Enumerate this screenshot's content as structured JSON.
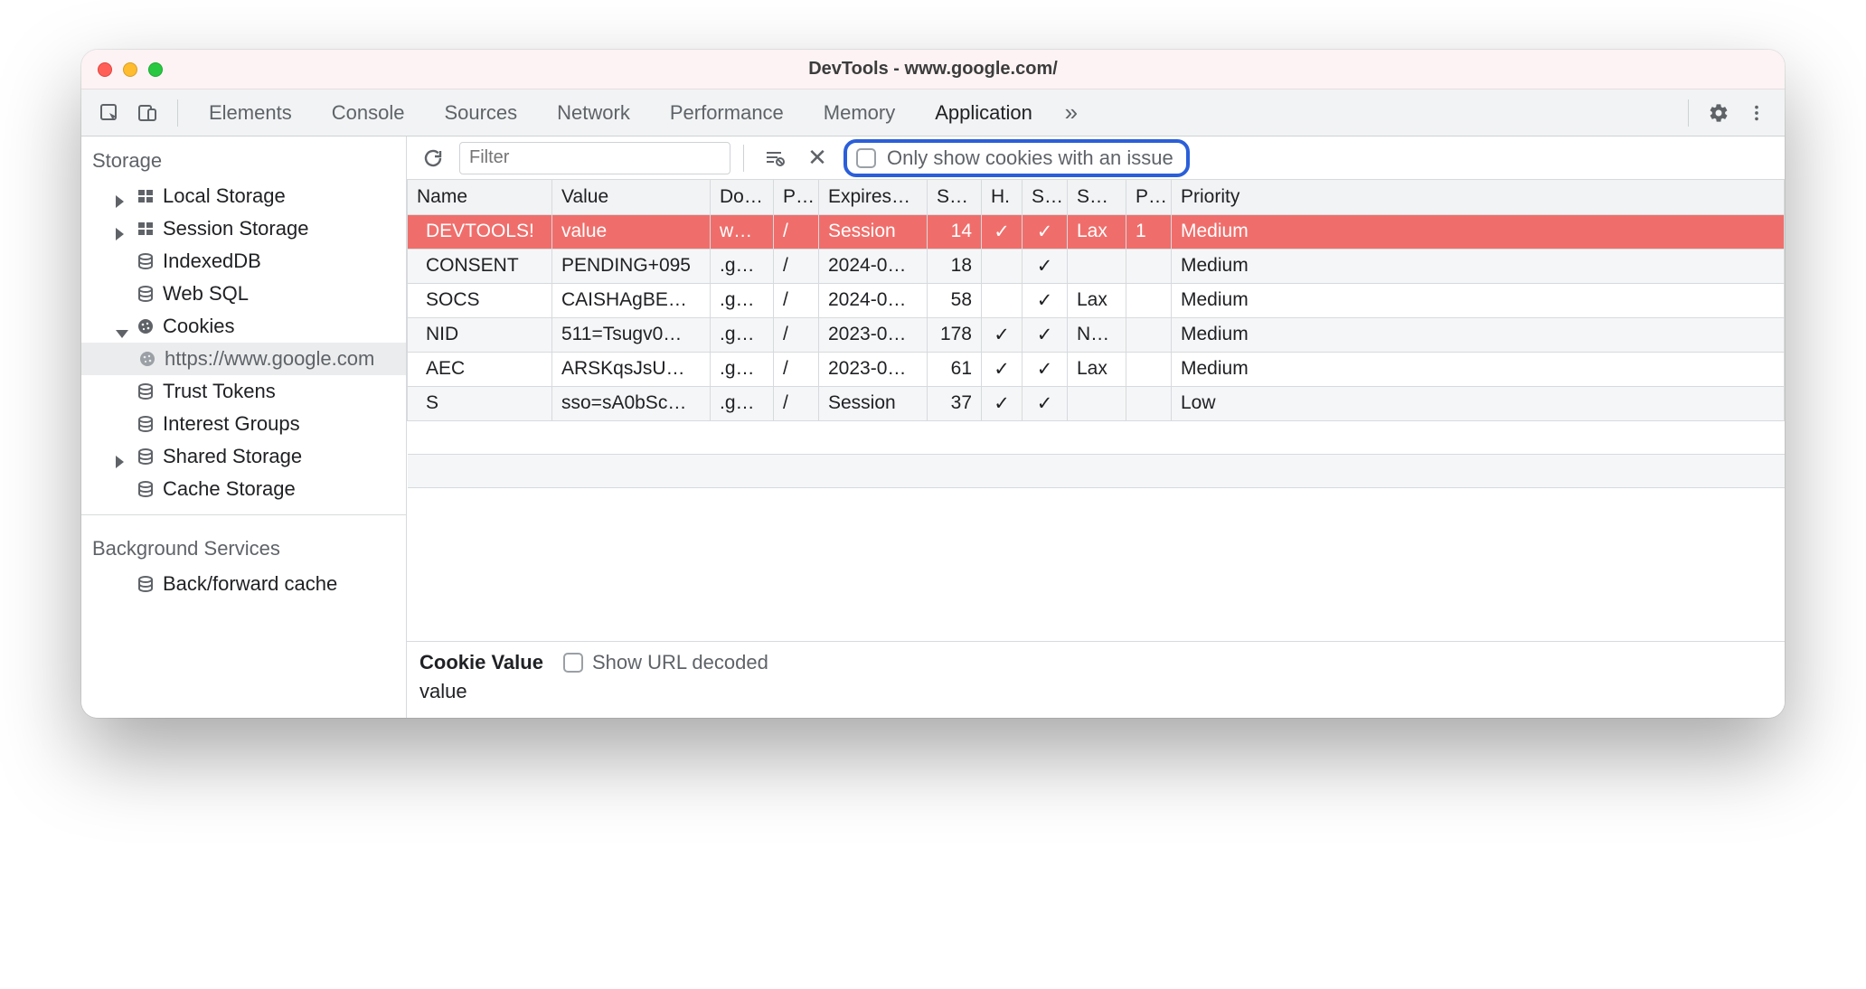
{
  "window_title": "DevTools - www.google.com/",
  "tabs": {
    "elements": "Elements",
    "console": "Console",
    "sources": "Sources",
    "network": "Network",
    "performance": "Performance",
    "memory": "Memory",
    "application": "Application"
  },
  "sidebar": {
    "group_storage": "Storage",
    "items": {
      "local_storage": "Local Storage",
      "session_storage": "Session Storage",
      "indexeddb": "IndexedDB",
      "web_sql": "Web SQL",
      "cookies": "Cookies",
      "cookies_origin": "https://www.google.com",
      "trust_tokens": "Trust Tokens",
      "interest_groups": "Interest Groups",
      "shared_storage": "Shared Storage",
      "cache_storage": "Cache Storage"
    },
    "group_background": "Background Services",
    "bg_back_forward_cache": "Back/forward cache"
  },
  "toolbar": {
    "filter_placeholder": "Filter",
    "only_issue_label": "Only show cookies with an issue"
  },
  "table": {
    "headers": {
      "name": "Name",
      "value": "Value",
      "domain": "Do…",
      "path": "P…",
      "expires": "Expires…",
      "size": "Size",
      "httponly": "H.",
      "secure": "S…",
      "samesite": "Sa…",
      "partition": "P…",
      "priority": "Priority"
    },
    "rows": [
      {
        "name": "DEVTOOLS!",
        "value": "value",
        "domain": "ww…",
        "path": "/",
        "expires": "Session",
        "size": "14",
        "httponly": "✓",
        "secure": "✓",
        "samesite": "Lax",
        "partition": "1",
        "priority": "Medium",
        "selected": true
      },
      {
        "name": "CONSENT",
        "value": "PENDING+095",
        "domain": ".go…",
        "path": "/",
        "expires": "2024-0…",
        "size": "18",
        "httponly": "",
        "secure": "✓",
        "samesite": "",
        "partition": "",
        "priority": "Medium"
      },
      {
        "name": "SOCS",
        "value": "CAISHAgBE…",
        "domain": ".go…",
        "path": "/",
        "expires": "2024-0…",
        "size": "58",
        "httponly": "",
        "secure": "✓",
        "samesite": "Lax",
        "partition": "",
        "priority": "Medium"
      },
      {
        "name": "NID",
        "value": "511=Tsugv0…",
        "domain": ".go…",
        "path": "/",
        "expires": "2023-0…",
        "size": "178",
        "httponly": "✓",
        "secure": "✓",
        "samesite": "No…",
        "partition": "",
        "priority": "Medium"
      },
      {
        "name": "AEC",
        "value": "ARSKqsJsU…",
        "domain": ".go…",
        "path": "/",
        "expires": "2023-0…",
        "size": "61",
        "httponly": "✓",
        "secure": "✓",
        "samesite": "Lax",
        "partition": "",
        "priority": "Medium"
      },
      {
        "name": "S",
        "value": "sso=sA0bSc…",
        "domain": ".go…",
        "path": "/",
        "expires": "Session",
        "size": "37",
        "httponly": "✓",
        "secure": "✓",
        "samesite": "",
        "partition": "",
        "priority": "Low"
      }
    ]
  },
  "detail": {
    "label": "Cookie Value",
    "show_decoded": "Show URL decoded",
    "value": "value"
  }
}
